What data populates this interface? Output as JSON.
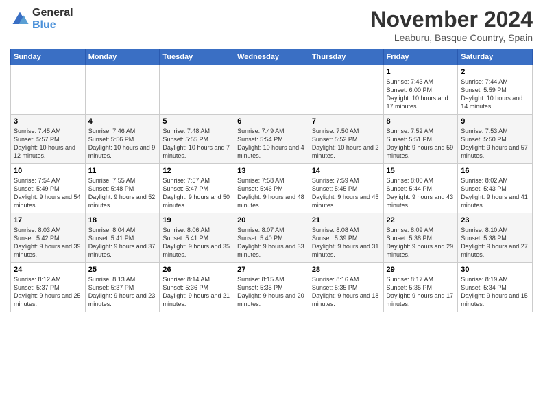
{
  "header": {
    "logo_general": "General",
    "logo_blue": "Blue",
    "title": "November 2024",
    "location": "Leaburu, Basque Country, Spain"
  },
  "days_of_week": [
    "Sunday",
    "Monday",
    "Tuesday",
    "Wednesday",
    "Thursday",
    "Friday",
    "Saturday"
  ],
  "weeks": [
    [
      {
        "day": "",
        "info": ""
      },
      {
        "day": "",
        "info": ""
      },
      {
        "day": "",
        "info": ""
      },
      {
        "day": "",
        "info": ""
      },
      {
        "day": "",
        "info": ""
      },
      {
        "day": "1",
        "info": "Sunrise: 7:43 AM\nSunset: 6:00 PM\nDaylight: 10 hours and 17 minutes."
      },
      {
        "day": "2",
        "info": "Sunrise: 7:44 AM\nSunset: 5:59 PM\nDaylight: 10 hours and 14 minutes."
      }
    ],
    [
      {
        "day": "3",
        "info": "Sunrise: 7:45 AM\nSunset: 5:57 PM\nDaylight: 10 hours and 12 minutes."
      },
      {
        "day": "4",
        "info": "Sunrise: 7:46 AM\nSunset: 5:56 PM\nDaylight: 10 hours and 9 minutes."
      },
      {
        "day": "5",
        "info": "Sunrise: 7:48 AM\nSunset: 5:55 PM\nDaylight: 10 hours and 7 minutes."
      },
      {
        "day": "6",
        "info": "Sunrise: 7:49 AM\nSunset: 5:54 PM\nDaylight: 10 hours and 4 minutes."
      },
      {
        "day": "7",
        "info": "Sunrise: 7:50 AM\nSunset: 5:52 PM\nDaylight: 10 hours and 2 minutes."
      },
      {
        "day": "8",
        "info": "Sunrise: 7:52 AM\nSunset: 5:51 PM\nDaylight: 9 hours and 59 minutes."
      },
      {
        "day": "9",
        "info": "Sunrise: 7:53 AM\nSunset: 5:50 PM\nDaylight: 9 hours and 57 minutes."
      }
    ],
    [
      {
        "day": "10",
        "info": "Sunrise: 7:54 AM\nSunset: 5:49 PM\nDaylight: 9 hours and 54 minutes."
      },
      {
        "day": "11",
        "info": "Sunrise: 7:55 AM\nSunset: 5:48 PM\nDaylight: 9 hours and 52 minutes."
      },
      {
        "day": "12",
        "info": "Sunrise: 7:57 AM\nSunset: 5:47 PM\nDaylight: 9 hours and 50 minutes."
      },
      {
        "day": "13",
        "info": "Sunrise: 7:58 AM\nSunset: 5:46 PM\nDaylight: 9 hours and 48 minutes."
      },
      {
        "day": "14",
        "info": "Sunrise: 7:59 AM\nSunset: 5:45 PM\nDaylight: 9 hours and 45 minutes."
      },
      {
        "day": "15",
        "info": "Sunrise: 8:00 AM\nSunset: 5:44 PM\nDaylight: 9 hours and 43 minutes."
      },
      {
        "day": "16",
        "info": "Sunrise: 8:02 AM\nSunset: 5:43 PM\nDaylight: 9 hours and 41 minutes."
      }
    ],
    [
      {
        "day": "17",
        "info": "Sunrise: 8:03 AM\nSunset: 5:42 PM\nDaylight: 9 hours and 39 minutes."
      },
      {
        "day": "18",
        "info": "Sunrise: 8:04 AM\nSunset: 5:41 PM\nDaylight: 9 hours and 37 minutes."
      },
      {
        "day": "19",
        "info": "Sunrise: 8:06 AM\nSunset: 5:41 PM\nDaylight: 9 hours and 35 minutes."
      },
      {
        "day": "20",
        "info": "Sunrise: 8:07 AM\nSunset: 5:40 PM\nDaylight: 9 hours and 33 minutes."
      },
      {
        "day": "21",
        "info": "Sunrise: 8:08 AM\nSunset: 5:39 PM\nDaylight: 9 hours and 31 minutes."
      },
      {
        "day": "22",
        "info": "Sunrise: 8:09 AM\nSunset: 5:38 PM\nDaylight: 9 hours and 29 minutes."
      },
      {
        "day": "23",
        "info": "Sunrise: 8:10 AM\nSunset: 5:38 PM\nDaylight: 9 hours and 27 minutes."
      }
    ],
    [
      {
        "day": "24",
        "info": "Sunrise: 8:12 AM\nSunset: 5:37 PM\nDaylight: 9 hours and 25 minutes."
      },
      {
        "day": "25",
        "info": "Sunrise: 8:13 AM\nSunset: 5:37 PM\nDaylight: 9 hours and 23 minutes."
      },
      {
        "day": "26",
        "info": "Sunrise: 8:14 AM\nSunset: 5:36 PM\nDaylight: 9 hours and 21 minutes."
      },
      {
        "day": "27",
        "info": "Sunrise: 8:15 AM\nSunset: 5:35 PM\nDaylight: 9 hours and 20 minutes."
      },
      {
        "day": "28",
        "info": "Sunrise: 8:16 AM\nSunset: 5:35 PM\nDaylight: 9 hours and 18 minutes."
      },
      {
        "day": "29",
        "info": "Sunrise: 8:17 AM\nSunset: 5:35 PM\nDaylight: 9 hours and 17 minutes."
      },
      {
        "day": "30",
        "info": "Sunrise: 8:19 AM\nSunset: 5:34 PM\nDaylight: 9 hours and 15 minutes."
      }
    ]
  ]
}
